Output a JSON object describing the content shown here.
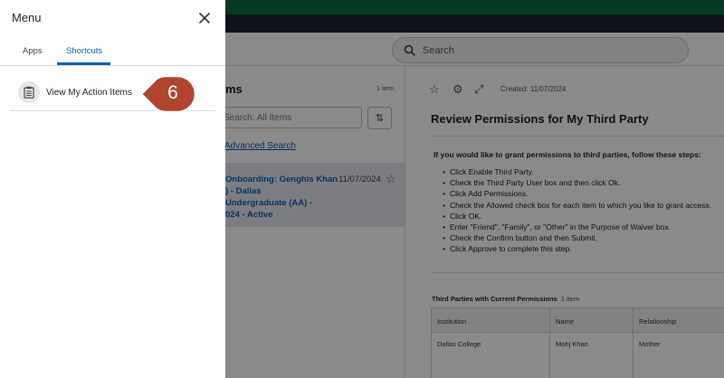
{
  "search": {
    "placeholder": "Search"
  },
  "list": {
    "title_partial": "ms",
    "count": "1 item",
    "search_placeholder": "Search: All Items",
    "advanced_search": "Advanced Search",
    "item": {
      "line1": "Onboarding: Genghis Khan",
      "line2": ") - Dallas",
      "line3": "Undergraduate (AA) -",
      "line4": "024 - Active",
      "date": "11/07/2024"
    }
  },
  "detail": {
    "created": "Created: 11/07/2024",
    "title": "Review Permissions for My Third Party",
    "intro": "If you would like to grant permissions to third parties, follow these steps:",
    "steps": [
      "Click Enable Third Party.",
      "Check the Third Party User box and then click Ok.",
      "Click Add Permissions.",
      "Check the Allowed check box for each item to which you like to grant access.",
      "Click OK.",
      "Enter \"Friend\", \"Family\", or \"Other\" in the Purpose of Waiver box.",
      "Check the Confirm button and then Submit.",
      "Click Approve to complete this step."
    ],
    "table": {
      "caption": "Third Parties with Current Permissions",
      "count": "1 item",
      "headers": [
        "Institution",
        "Name",
        "Relationship"
      ],
      "rows": [
        [
          "Dallas College",
          "Mohj Khan",
          "Mother"
        ]
      ]
    }
  },
  "menu": {
    "title": "Menu",
    "tabs": [
      {
        "label": "Apps"
      },
      {
        "label": "Shortcuts"
      }
    ],
    "shortcuts": [
      {
        "label": "View My Action Items",
        "icon": "clipboard-icon"
      }
    ]
  },
  "callout": {
    "number": "6",
    "color": "#b0442f"
  },
  "colors": {
    "accent": "#0a5fb4",
    "top_green": "#0b6b3f",
    "top_dark": "#1d2630"
  }
}
